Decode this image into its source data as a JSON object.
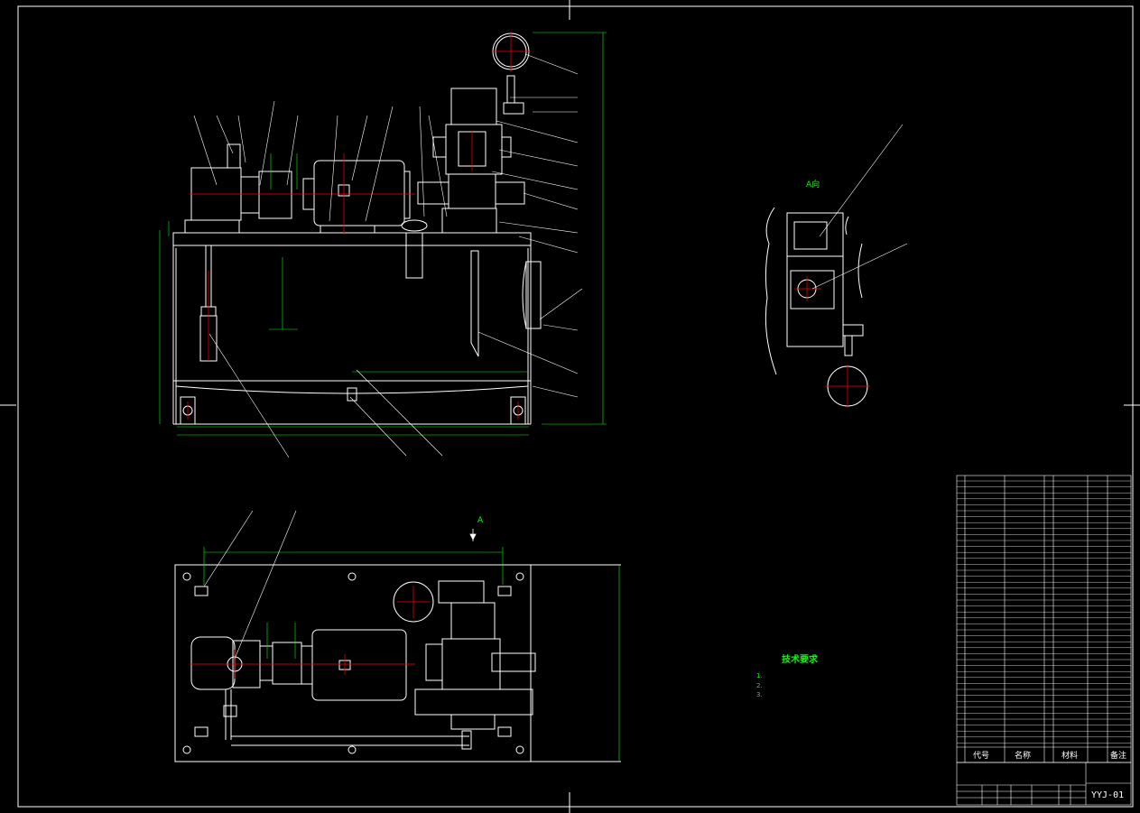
{
  "drawing": {
    "colors": {
      "background": "#000000",
      "outline": "#ffffff",
      "dimension": "#00ff00",
      "centerline": "#ff0000",
      "accent": "#00ffff"
    },
    "tech_requirements": {
      "title": "技术要求",
      "items": [
        "1.",
        "2.",
        "3."
      ]
    },
    "view_label": "A向",
    "view_arrow_label": "A",
    "bom_header": {
      "code": "代号",
      "name": "名称",
      "material": "材料",
      "note": "备注"
    },
    "drawing_number": "YYJ-01"
  }
}
